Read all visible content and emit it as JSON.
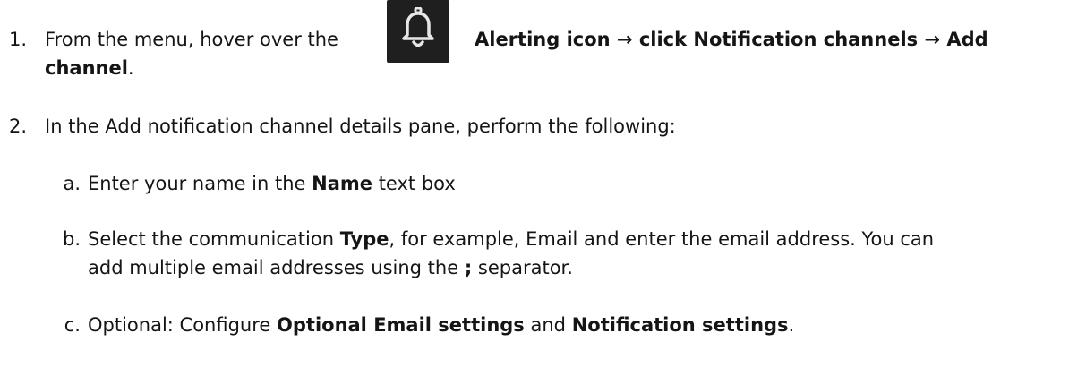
{
  "step1": {
    "number": "1.",
    "pre": "From the menu, hover over the",
    "icon": "bell-icon",
    "bold_a": "Alerting icon → click Notification channels → Add",
    "bold_b": "channel",
    "post": "."
  },
  "step2": {
    "number": "2.",
    "text": "In the Add notification channel details pane, perform the following:"
  },
  "sub_a": {
    "letter": "a.",
    "pre": "Enter your name in the",
    "bold": "Name",
    "post": "text box"
  },
  "sub_b": {
    "letter": "b.",
    "pre": "Select the communication",
    "bold": "Type",
    "post": ", for example, Email and enter the email address. You can",
    "line2_pre": "add multiple email addresses using the",
    "line2_bold": ";",
    "line2_post": "separator."
  },
  "sub_c": {
    "letter": "c.",
    "pre": "Optional: Configure",
    "bold1": "Optional Email settings",
    "mid": "and",
    "bold2": "Notification settings",
    "post": "."
  }
}
